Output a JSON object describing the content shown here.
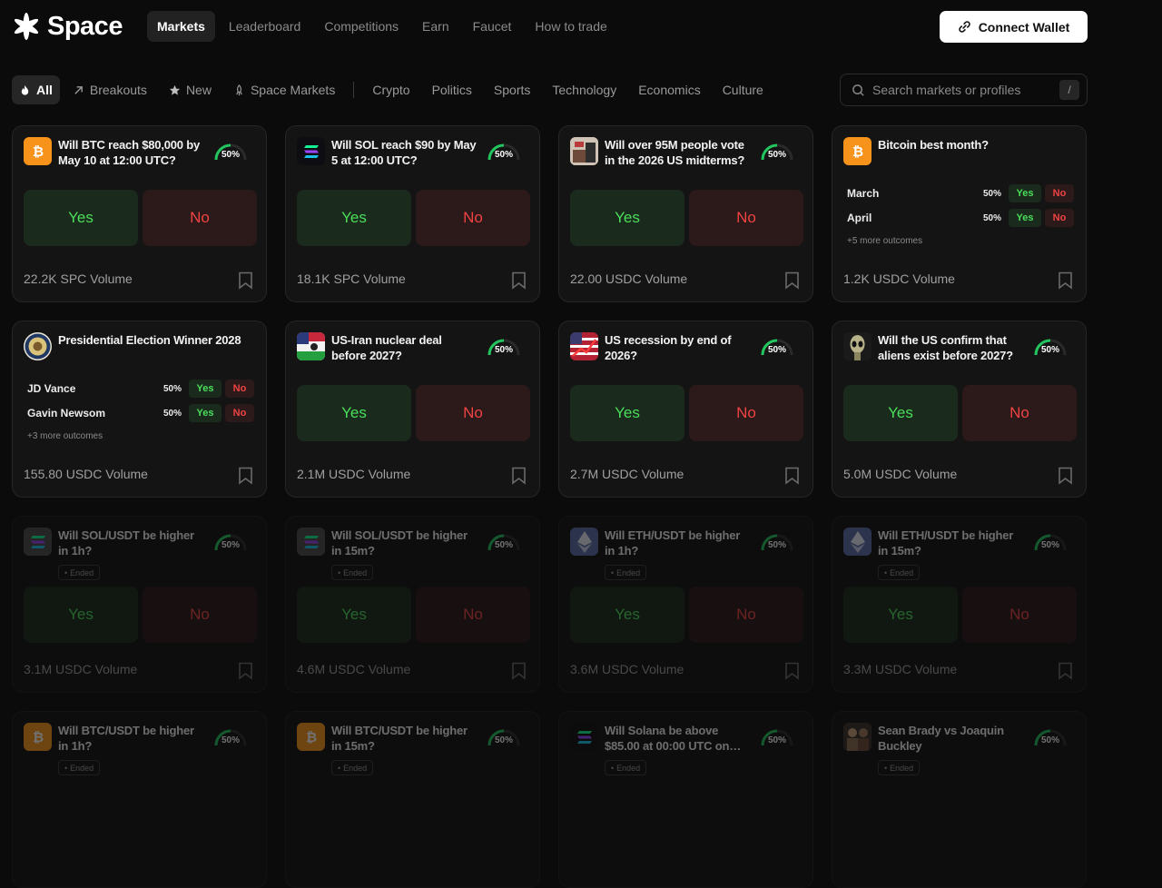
{
  "app": {
    "name": "Space"
  },
  "nav": {
    "items": [
      {
        "label": "Markets",
        "active": true
      },
      {
        "label": "Leaderboard"
      },
      {
        "label": "Competitions"
      },
      {
        "label": "Earn"
      },
      {
        "label": "Faucet"
      },
      {
        "label": "How to trade"
      }
    ],
    "connect_label": "Connect Wallet"
  },
  "categories": {
    "primary": [
      {
        "label": "All",
        "icon": "fire-icon",
        "active": true
      },
      {
        "label": "Breakouts",
        "icon": "arrow-up-right-icon"
      },
      {
        "label": "New",
        "icon": "star-icon"
      },
      {
        "label": "Space Markets",
        "icon": "rocket-icon"
      }
    ],
    "topics": [
      "Crypto",
      "Politics",
      "Sports",
      "Technology",
      "Economics",
      "Culture"
    ]
  },
  "search": {
    "placeholder": "Search markets or profiles",
    "shortcut": "/"
  },
  "labels": {
    "yes": "Yes",
    "no": "No",
    "ended": "Ended"
  },
  "colors": {
    "yes": "#4ade5a",
    "no": "#ef4343",
    "gauge": "#22c55e",
    "bitcoin": "#f7931a"
  },
  "cards": [
    {
      "title": "Will BTC reach $80,000 by May 10 at 12:00 UTC?",
      "icon": "bitcoin-icon",
      "chance": "50%",
      "volume": "22.2K SPC Volume"
    },
    {
      "title": "Will SOL reach $90 by May 5 at 12:00 UTC?",
      "icon": "solana-icon",
      "chance": "50%",
      "volume": "18.1K SPC Volume"
    },
    {
      "title": "Will over 95M people vote in the 2026 US midterms?",
      "icon": "vote-image-icon",
      "chance": "50%",
      "volume": "22.00 USDC Volume"
    },
    {
      "title": "Bitcoin best month?",
      "icon": "bitcoin-icon",
      "volume": "1.2K USDC Volume",
      "outcomes": [
        {
          "name": "March",
          "chance": "50%"
        },
        {
          "name": "April",
          "chance": "50%"
        }
      ],
      "more": "+5 more outcomes"
    },
    {
      "title": "Presidential Election Winner 2028",
      "icon": "presidential-seal-icon",
      "volume": "155.80 USDC Volume",
      "outcomes": [
        {
          "name": "JD Vance",
          "chance": "50%"
        },
        {
          "name": "Gavin Newsom",
          "chance": "50%"
        }
      ],
      "more": "+3 more outcomes"
    },
    {
      "title": "US-Iran nuclear deal before 2027?",
      "icon": "us-iran-flag-icon",
      "chance": "50%",
      "volume": "2.1M USDC Volume"
    },
    {
      "title": "US recession by end of 2026?",
      "icon": "us-flag-chart-icon",
      "chance": "50%",
      "volume": "2.7M USDC Volume"
    },
    {
      "title": "Will the US confirm that aliens exist before 2027?",
      "icon": "alien-icon",
      "chance": "50%",
      "volume": "5.0M USDC Volume"
    },
    {
      "title": "Will SOL/USDT be higher in 1h?",
      "icon": "solana-icon",
      "chance": "50%",
      "volume": "3.1M USDC Volume",
      "ended": true
    },
    {
      "title": "Will SOL/USDT be higher in 15m?",
      "icon": "solana-icon",
      "chance": "50%",
      "volume": "4.6M USDC Volume",
      "ended": true
    },
    {
      "title": "Will ETH/USDT be higher in 1h?",
      "icon": "ethereum-icon",
      "chance": "50%",
      "volume": "3.6M USDC Volume",
      "ended": true
    },
    {
      "title": "Will ETH/USDT be higher in 15m?",
      "icon": "ethereum-icon",
      "chance": "50%",
      "volume": "3.3M USDC Volume",
      "ended": true
    },
    {
      "title": "Will BTC/USDT be higher in 1h?",
      "icon": "bitcoin-icon",
      "chance": "50%",
      "ended": true
    },
    {
      "title": "Will BTC/USDT be higher in 15m?",
      "icon": "bitcoin-icon",
      "chance": "50%",
      "ended": true
    },
    {
      "title": "Will Solana be above $85.00 at 00:00 UTC on…",
      "icon": "solana-icon",
      "chance": "50%",
      "ended": true
    },
    {
      "title": "Sean Brady vs Joaquin Buckley",
      "icon": "fighters-image-icon",
      "chance": "50%",
      "ended": true
    }
  ]
}
